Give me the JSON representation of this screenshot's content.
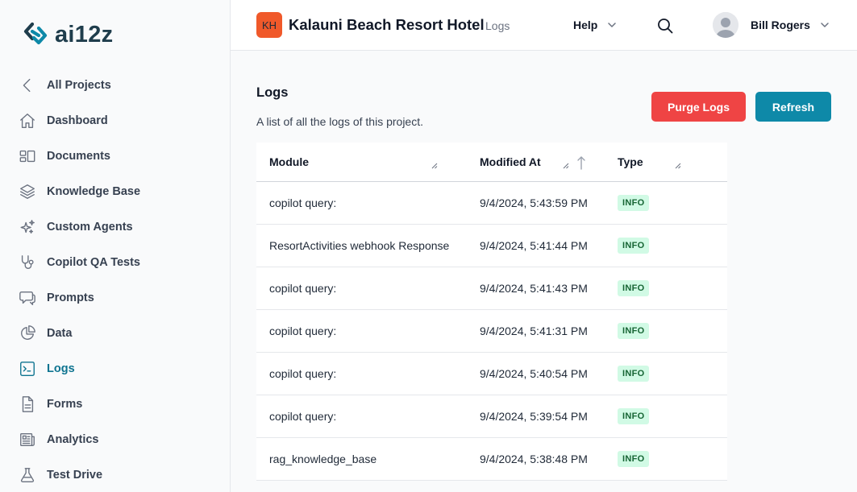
{
  "brand": {
    "logo_text": "ai12z",
    "logo_color": "#1f3d4c",
    "accent": "#0e7490"
  },
  "sidebar": {
    "items": [
      {
        "label": "All Projects",
        "icon": "chevron-left-icon"
      },
      {
        "label": "Dashboard",
        "icon": "home-icon"
      },
      {
        "label": "Documents",
        "icon": "documents-icon"
      },
      {
        "label": "Knowledge Base",
        "icon": "layers-icon"
      },
      {
        "label": "Custom Agents",
        "icon": "sparkles-icon"
      },
      {
        "label": "Copilot QA Tests",
        "icon": "stethoscope-icon"
      },
      {
        "label": "Prompts",
        "icon": "chat-bubbles-icon"
      },
      {
        "label": "Data",
        "icon": "pie-chart-icon"
      },
      {
        "label": "Logs",
        "icon": "terminal-icon",
        "active": true
      },
      {
        "label": "Forms",
        "icon": "document-text-icon"
      },
      {
        "label": "Analytics",
        "icon": "newspaper-icon"
      },
      {
        "label": "Test Drive",
        "icon": "beaker-icon"
      }
    ]
  },
  "header": {
    "project_initials": "KH",
    "project_badge_color": "#f0592a",
    "project_name": "Kalauni Beach Resort Hotel",
    "section": "Logs",
    "help_label": "Help",
    "user_name": "Bill Rogers"
  },
  "main": {
    "title": "Logs",
    "description": "A list of all the logs of this project.",
    "purge_label": "Purge Logs",
    "purge_color": "#ef4444",
    "refresh_label": "Refresh",
    "refresh_color": "#0e89a8",
    "table": {
      "columns": [
        "Module",
        "Modified At",
        "Type"
      ],
      "sort_column": "Modified At",
      "rows": [
        {
          "module": "copilot query:",
          "modified_at": "9/4/2024, 5:43:59 PM",
          "type": "INFO"
        },
        {
          "module": "ResortActivities webhook Response",
          "modified_at": "9/4/2024, 5:41:44 PM",
          "type": "INFO"
        },
        {
          "module": "copilot query:",
          "modified_at": "9/4/2024, 5:41:43 PM",
          "type": "INFO"
        },
        {
          "module": "copilot query:",
          "modified_at": "9/4/2024, 5:41:31 PM",
          "type": "INFO"
        },
        {
          "module": "copilot query:",
          "modified_at": "9/4/2024, 5:40:54 PM",
          "type": "INFO"
        },
        {
          "module": "copilot query:",
          "modified_at": "9/4/2024, 5:39:54 PM",
          "type": "INFO"
        },
        {
          "module": "rag_knowledge_base",
          "modified_at": "9/4/2024, 5:38:48 PM",
          "type": "INFO"
        }
      ]
    }
  }
}
